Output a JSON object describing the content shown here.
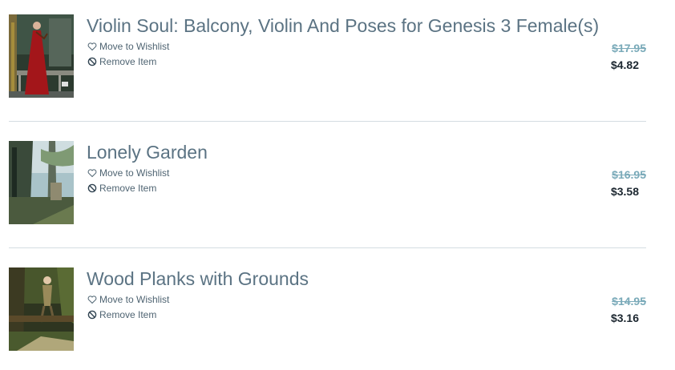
{
  "cart": {
    "items": [
      {
        "title": "Violin Soul: Balcony, Violin And Poses for Genesis 3 Female(s)",
        "wishlist_label": "Move to Wishlist",
        "remove_label": "Remove Item",
        "original_price": "$17.95",
        "sale_price": "$4.82",
        "thumbnail": "violin-soul-thumbnail"
      },
      {
        "title": "Lonely Garden",
        "wishlist_label": "Move to Wishlist",
        "remove_label": "Remove Item",
        "original_price": "$16.95",
        "sale_price": "$3.58",
        "thumbnail": "lonely-garden-thumbnail"
      },
      {
        "title": "Wood Planks with Grounds",
        "wishlist_label": "Move to Wishlist",
        "remove_label": "Remove Item",
        "original_price": "$14.95",
        "sale_price": "$3.16",
        "thumbnail": "wood-planks-thumbnail"
      }
    ]
  },
  "icons": {
    "wishlist": "heart-outline-icon",
    "remove": "prohibited-circle-icon"
  },
  "colors": {
    "title": "#5b7383",
    "action_text": "#4f6472",
    "original_price": "#7aaab9",
    "sale_price": "#1c2730",
    "divider": "#d4dde2"
  }
}
